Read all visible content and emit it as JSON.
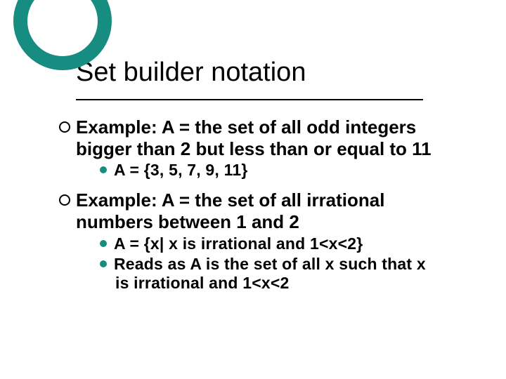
{
  "title": "Set builder notation",
  "bullets": [
    {
      "line": "Example: A = the set of all odd integers bigger than 2 but less than or equal to 11",
      "sub": [
        {
          "text": "A = {3, 5, 7, 9, 11}"
        }
      ]
    },
    {
      "line": "Example: A = the set of all irrational numbers between 1 and 2",
      "sub": [
        {
          "text": "A = {x| x is irrational and 1<x<2}"
        },
        {
          "text": "Reads as A is the set of all x such that x is irrational and 1<x<2"
        }
      ]
    }
  ]
}
